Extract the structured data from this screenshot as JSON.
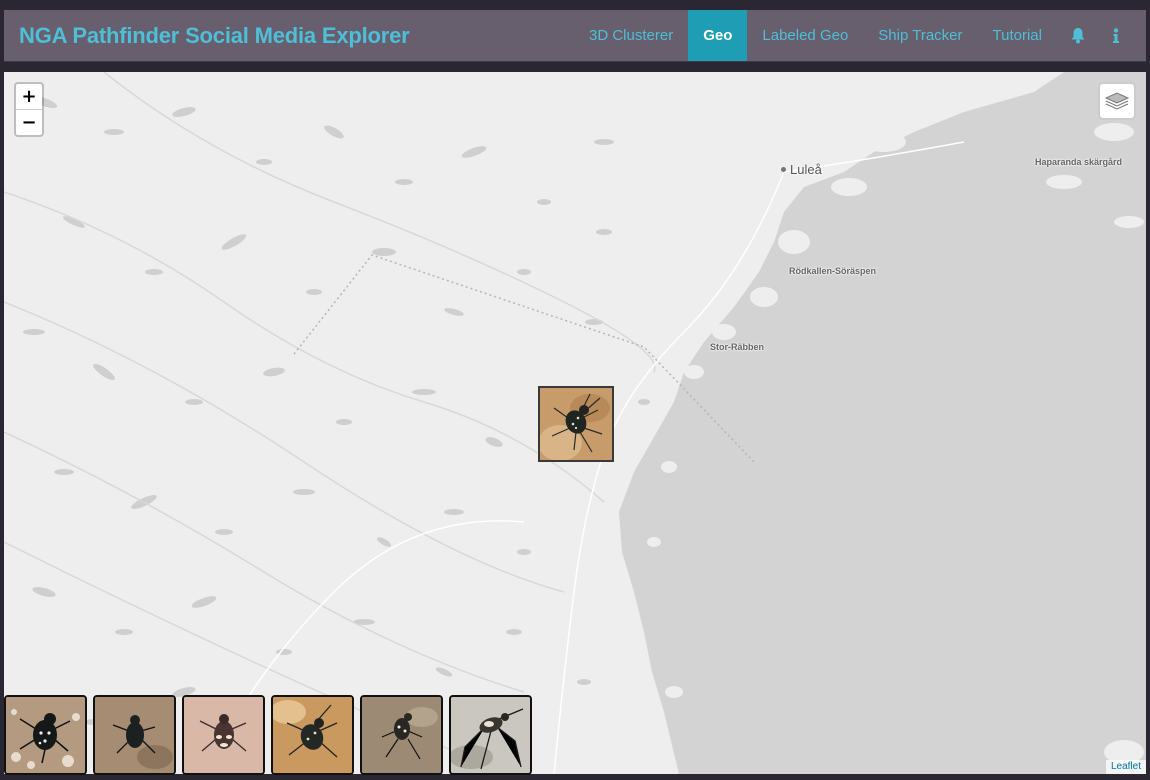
{
  "navbar": {
    "brand": "NGA Pathfinder Social Media Explorer",
    "links": [
      {
        "label": "3D Clusterer",
        "active": false
      },
      {
        "label": "Geo",
        "active": true
      },
      {
        "label": "Labeled Geo",
        "active": false
      },
      {
        "label": "Ship Tracker",
        "active": false
      },
      {
        "label": "Tutorial",
        "active": false
      }
    ],
    "icons": [
      "bell-icon",
      "info-icon",
      "chat-icon"
    ],
    "accent_color": "#4dbfd6",
    "active_color": "#1f9db5"
  },
  "map": {
    "zoom_in": "+",
    "zoom_out": "−",
    "labels": {
      "lulea": "Luleå",
      "haparanda": "Haparanda skärgård",
      "rodkallen": "Rödkallen-Söräspen",
      "stor_rabben": "Stor-Räbben"
    },
    "attribution": "Leaflet",
    "layers_icon": "layers-icon",
    "marker": "beetle-photo-marker"
  },
  "thumbnails": [
    {
      "subject": "tiger beetle on gravel"
    },
    {
      "subject": "dark beetle on sand"
    },
    {
      "subject": "beetle on pink sand"
    },
    {
      "subject": "tiger beetle on orange sand"
    },
    {
      "subject": "beetle on brown sand"
    },
    {
      "subject": "long-legged beetle on pale sand"
    }
  ]
}
